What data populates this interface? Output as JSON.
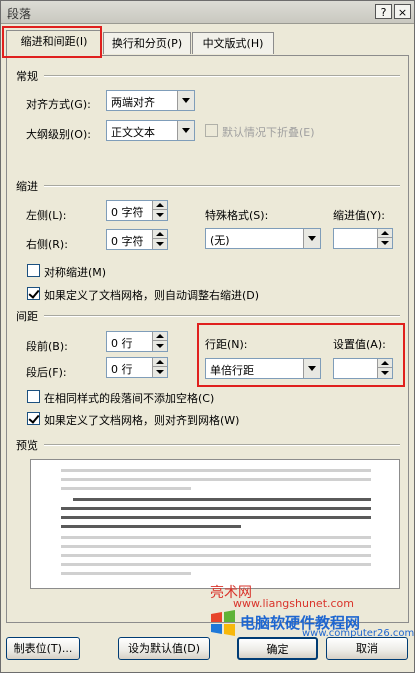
{
  "dialog": {
    "title": "段落",
    "help_glyph": "?",
    "close_glyph": "×"
  },
  "tabs": [
    {
      "label": "缩进和间距(I)",
      "active": true
    },
    {
      "label": "换行和分页(P)",
      "active": false
    },
    {
      "label": "中文版式(H)",
      "active": false
    }
  ],
  "general": {
    "header": "常规",
    "alignment_label": "对齐方式(G):",
    "alignment_value": "两端对齐",
    "outline_label": "大纲级别(O):",
    "outline_value": "正文文本",
    "collapse_label": "默认情况下折叠(E)"
  },
  "indent": {
    "header": "缩进",
    "left_label": "左侧(L):",
    "left_value": "0 字符",
    "right_label": "右侧(R):",
    "right_value": "0 字符",
    "special_label": "特殊格式(S):",
    "special_value": "(无)",
    "by_label": "缩进值(Y):",
    "by_value": "",
    "mirror_label": "对称缩进(M)",
    "auto_adjust_label": "如果定义了文档网格，则自动调整右缩进(D)"
  },
  "spacing": {
    "header": "间距",
    "before_label": "段前(B):",
    "before_value": "0 行",
    "after_label": "段后(F):",
    "after_value": "0 行",
    "line_label": "行距(N):",
    "line_value": "单倍行距",
    "at_label": "设置值(A):",
    "at_value": "",
    "no_space_label": "在相同样式的段落间不添加空格(C)",
    "snap_grid_label": "如果定义了文档网格，则对齐到网格(W)"
  },
  "preview": {
    "header": "预览"
  },
  "buttons": {
    "tabs": "制表位(T)...",
    "set_default": "设为默认值(D)",
    "ok": "确定",
    "cancel": "取消"
  },
  "watermark": {
    "site_cn": "亮术网",
    "site_url": "www.liangshunet.com",
    "brand": "电脑软硬件教程网",
    "brand_url": "www.computer26.com"
  },
  "colors": {
    "highlight": "#e0201e",
    "watermark_red": "#d9342b",
    "watermark_blue": "#1e66d0"
  }
}
